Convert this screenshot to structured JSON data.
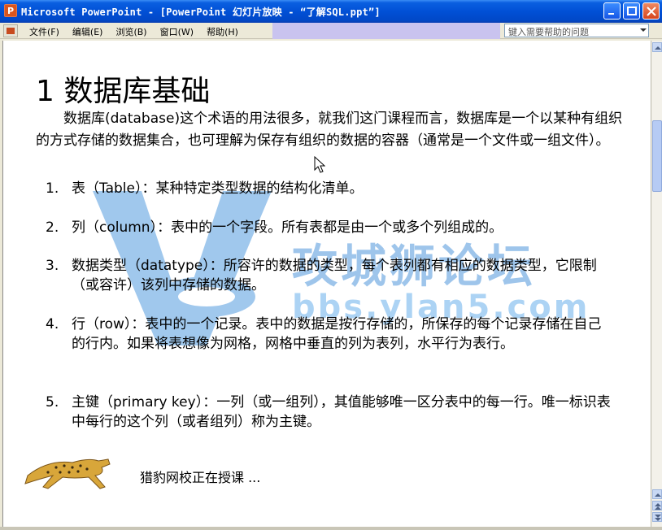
{
  "window": {
    "title": "Microsoft PowerPoint - [PowerPoint 幻灯片放映 - “了解SQL.ppt”]",
    "icon": "powerpoint-icon"
  },
  "menu": {
    "items": [
      "文件(F)",
      "编辑(E)",
      "浏览(B)",
      "窗口(W)",
      "帮助(H)"
    ],
    "help_placeholder": "键入需要帮助的问题"
  },
  "slide": {
    "title": "1 数据库基础",
    "intro": "数据库(database)这个术语的用法很多，就我们这门课程而言，数据库是一个以某种有组织的方式存储的数据集合，也可理解为保存有组织的数据的容器（通常是一个文件或一组文件）。",
    "items": [
      {
        "num": "1.",
        "text": "表（Table）：某种特定类型数据的结构化清单。"
      },
      {
        "num": "2.",
        "text": "列（column）：表中的一个字段。所有表都是由一个或多个列组成的。"
      },
      {
        "num": "3.",
        "text": "数据类型（datatype）：所容许的数据的类型，每个表列都有相应的数据类型，它限制（或容许）该列中存储的数据。"
      },
      {
        "num": "4.",
        "text": "行（row）：表中的一个记录。表中的数据是按行存储的，所保存的每个记录存储在自己的行内。如果将表想像为网格，网格中垂直的列为表列，水平行为表行。"
      },
      {
        "num": "5.",
        "text": "主键（primary key）：一列（或一组列），其值能够唯一区分表中的每一行。唯一标识表中每行的这个列（或者组列）称为主键。"
      }
    ],
    "lecture_text": "猎豹网校正在授课 ...",
    "watermark_cn": "攻城狮论坛",
    "watermark_url": "bbs.ylan5.com"
  },
  "colors": {
    "titlebar": "#0150d6",
    "watermark": "#2a7fd4"
  }
}
